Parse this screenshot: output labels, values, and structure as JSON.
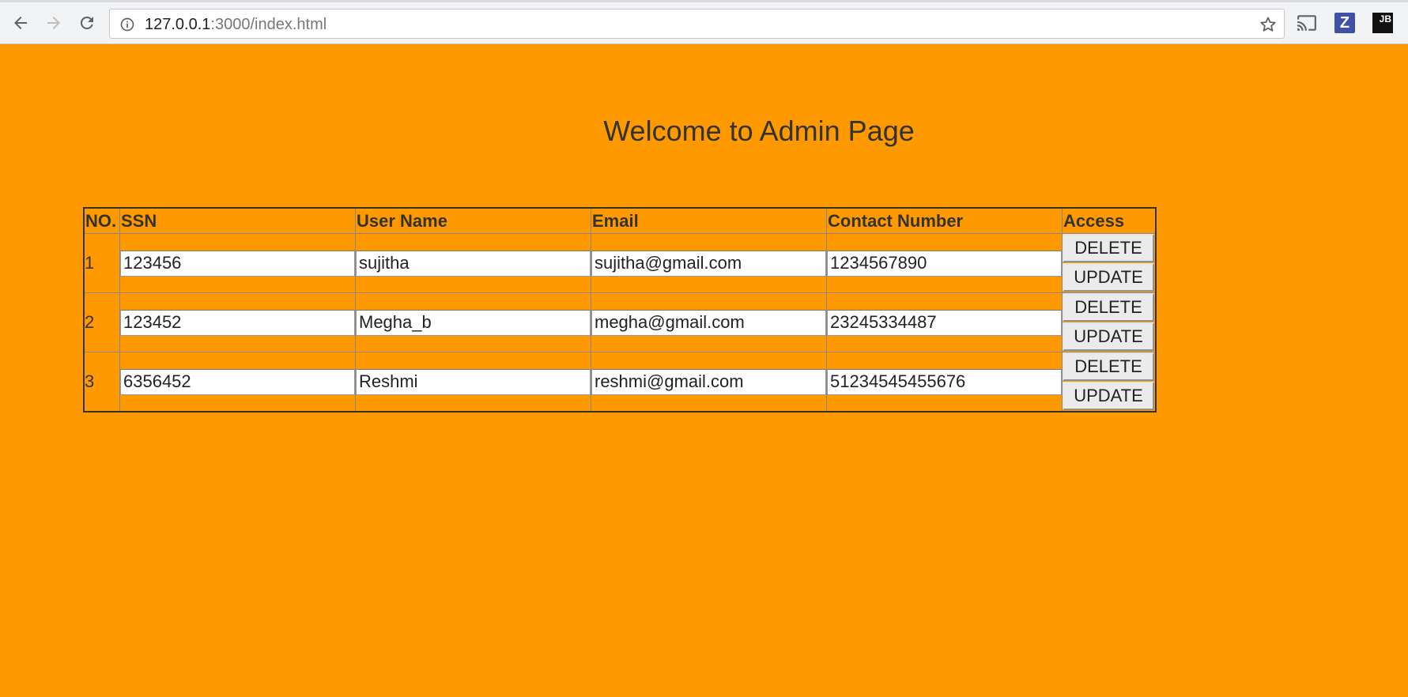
{
  "browser": {
    "url_host": "127.0.0.1",
    "url_rest": ":3000/index.html",
    "icons": {
      "back": "back-arrow-icon",
      "forward": "forward-arrow-icon",
      "reload": "reload-icon",
      "info": "info-icon",
      "bookmark": "star-icon",
      "cast": "cast-icon",
      "ext1": "z-extension-icon",
      "ext2": "jb-extension-icon"
    },
    "ext1_label": "Z",
    "ext2_label": "JB"
  },
  "page": {
    "title": "Welcome to Admin Page",
    "background": "#ff9900"
  },
  "table": {
    "headers": [
      "NO.",
      "SSN",
      "User Name",
      "Email",
      "Contact Number",
      "Access"
    ],
    "delete_label": "DELETE",
    "update_label": "UPDATE",
    "rows": [
      {
        "no": "1",
        "ssn": "123456",
        "username": "sujitha",
        "email": "sujitha@gmail.com",
        "contact": "1234567890"
      },
      {
        "no": "2",
        "ssn": "123452",
        "username": "Megha_b",
        "email": "megha@gmail.com",
        "contact": "23245334487"
      },
      {
        "no": "3",
        "ssn": "6356452",
        "username": "Reshmi",
        "email": "reshmi@gmail.com",
        "contact": "51234545455676"
      }
    ]
  }
}
